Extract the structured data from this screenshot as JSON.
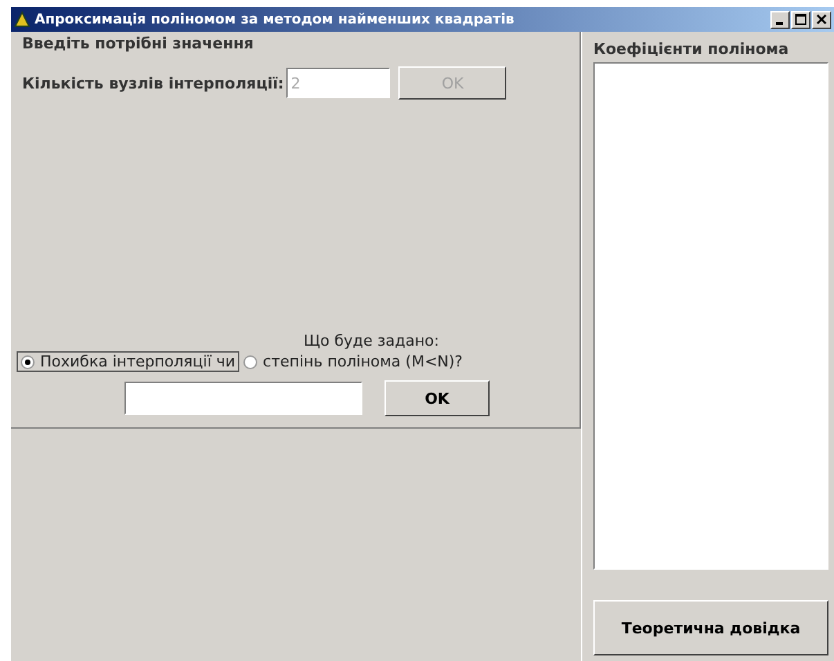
{
  "window": {
    "title": "Апроксимація поліномом за методом найменших квадратів"
  },
  "input_group": {
    "title": "Введіть потрібні значення",
    "nodes_label": "Кількість вузлів інтерполяції:",
    "nodes_value": "2",
    "nodes_ok": {
      "label": "OK",
      "disabled": true
    },
    "question": "Що буде задано:",
    "options": [
      {
        "label": "Похибка інтерполяції чи",
        "selected": true
      },
      {
        "label": "степінь полінома (M<N)?",
        "selected": false
      }
    ],
    "ok": {
      "label": "OK",
      "disabled": false
    }
  },
  "coefficients": {
    "title": "Коефіцієнти полінома"
  },
  "help_button": {
    "label": "Теоретична довідка"
  }
}
